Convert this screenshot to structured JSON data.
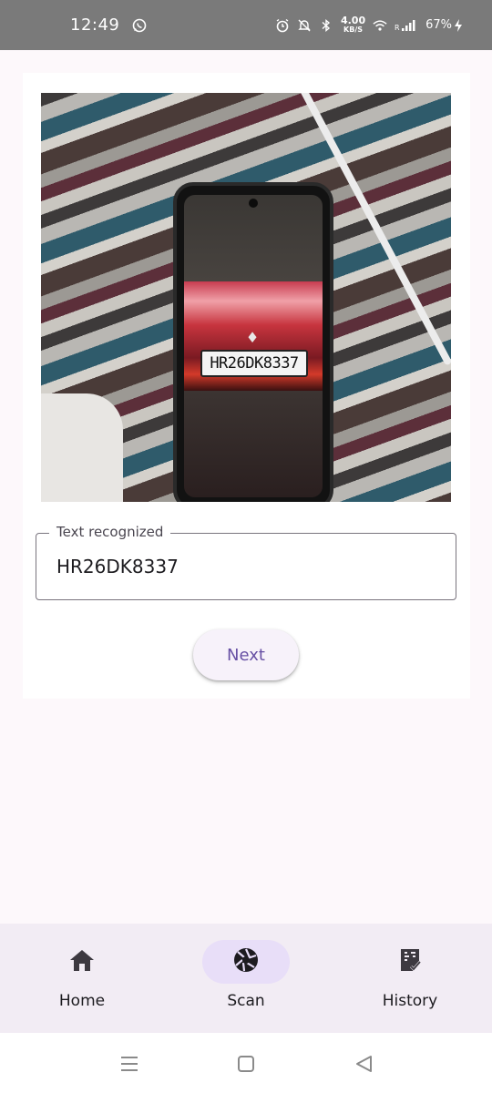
{
  "status_bar": {
    "time": "12:49",
    "network_speed_value": "4.00",
    "network_speed_unit": "KB/S",
    "battery": "67%",
    "icons": [
      "whatsapp-icon",
      "alarm-icon",
      "mute-icon",
      "bluetooth-icon",
      "wifi-icon",
      "signal-icon",
      "charging-icon"
    ]
  },
  "scan_result": {
    "photo": "captured-plate-photo",
    "plate_in_photo": "HR26DK8337",
    "field_label": "Text recognized",
    "field_value": "HR26DK8337",
    "next_label": "Next"
  },
  "bottom_nav": {
    "items": [
      {
        "label": "Home",
        "icon": "home-icon",
        "active": false
      },
      {
        "label": "Scan",
        "icon": "shutter-icon",
        "active": true
      },
      {
        "label": "History",
        "icon": "history-icon",
        "active": false
      }
    ]
  },
  "system_nav": [
    "recents-icon",
    "home-square-icon",
    "back-icon"
  ],
  "colors": {
    "accent": "#6750a4",
    "active_pill": "#e8def8",
    "nav_background": "#f2ecf4",
    "page_background": "#fdf8fb",
    "status_bar": "#7a7a7a"
  }
}
